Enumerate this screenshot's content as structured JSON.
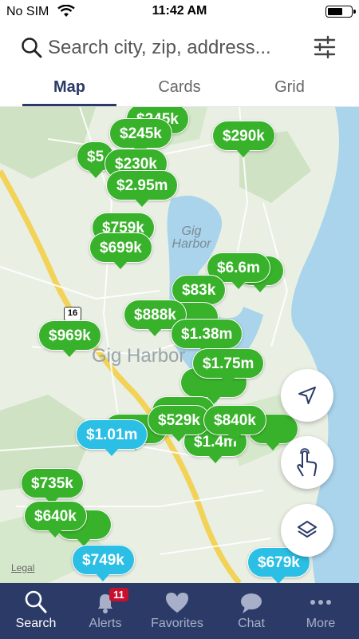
{
  "status": {
    "carrier": "No SIM",
    "time": "11:42 AM",
    "battery_level": 0.55
  },
  "search": {
    "placeholder": "Search city, zip, address..."
  },
  "tabs": [
    {
      "label": "Map"
    },
    {
      "label": "Cards"
    },
    {
      "label": "Grid"
    }
  ],
  "map": {
    "labels": {
      "harbor": "Gig\nHarbor",
      "town": "Gig Harbor",
      "highway": "16",
      "legal": "Legal"
    },
    "pins": [
      {
        "price": "$245k",
        "color": "green"
      },
      {
        "price": "$290k",
        "color": "green"
      },
      {
        "price": "$5",
        "color": "green"
      },
      {
        "price": "$230k",
        "color": "green"
      },
      {
        "price": "$2.95m",
        "color": "green"
      },
      {
        "price": "$759k",
        "color": "green"
      },
      {
        "price": "$699k",
        "color": "green"
      },
      {
        "price": "$6.6m",
        "color": "green"
      },
      {
        "price": "$83k",
        "color": "green"
      },
      {
        "price": "$888k",
        "color": "green"
      },
      {
        "price": "$969k",
        "color": "green"
      },
      {
        "price": "$1.38m",
        "color": "green"
      },
      {
        "price": "$1.75m",
        "color": "green"
      },
      {
        "price": "$529k",
        "color": "green"
      },
      {
        "price": "$840k",
        "color": "green"
      },
      {
        "price": "$1.4m",
        "color": "green"
      },
      {
        "price": "$1.01m",
        "color": "blue"
      },
      {
        "price": "$735k",
        "color": "green"
      },
      {
        "price": "$640k",
        "color": "green"
      },
      {
        "price": "$749k",
        "color": "blue"
      },
      {
        "price": "$679k",
        "color": "blue"
      }
    ]
  },
  "map_controls": [
    {
      "icon": "navigation-arrow-icon"
    },
    {
      "icon": "hand-draw-icon"
    },
    {
      "icon": "layers-icon"
    }
  ],
  "nav": {
    "items": [
      {
        "label": "Search",
        "icon": "search-icon"
      },
      {
        "label": "Alerts",
        "icon": "bell-icon",
        "badge": "11"
      },
      {
        "label": "Favorites",
        "icon": "heart-icon"
      },
      {
        "label": "Chat",
        "icon": "chat-icon"
      },
      {
        "label": "More",
        "icon": "more-dots-icon"
      }
    ]
  },
  "colors": {
    "accent": "#2b3a67",
    "pin_green": "#38b22a",
    "pin_blue": "#2bbfe5",
    "water": "#a9d4ec",
    "badge": "#c8102e"
  }
}
